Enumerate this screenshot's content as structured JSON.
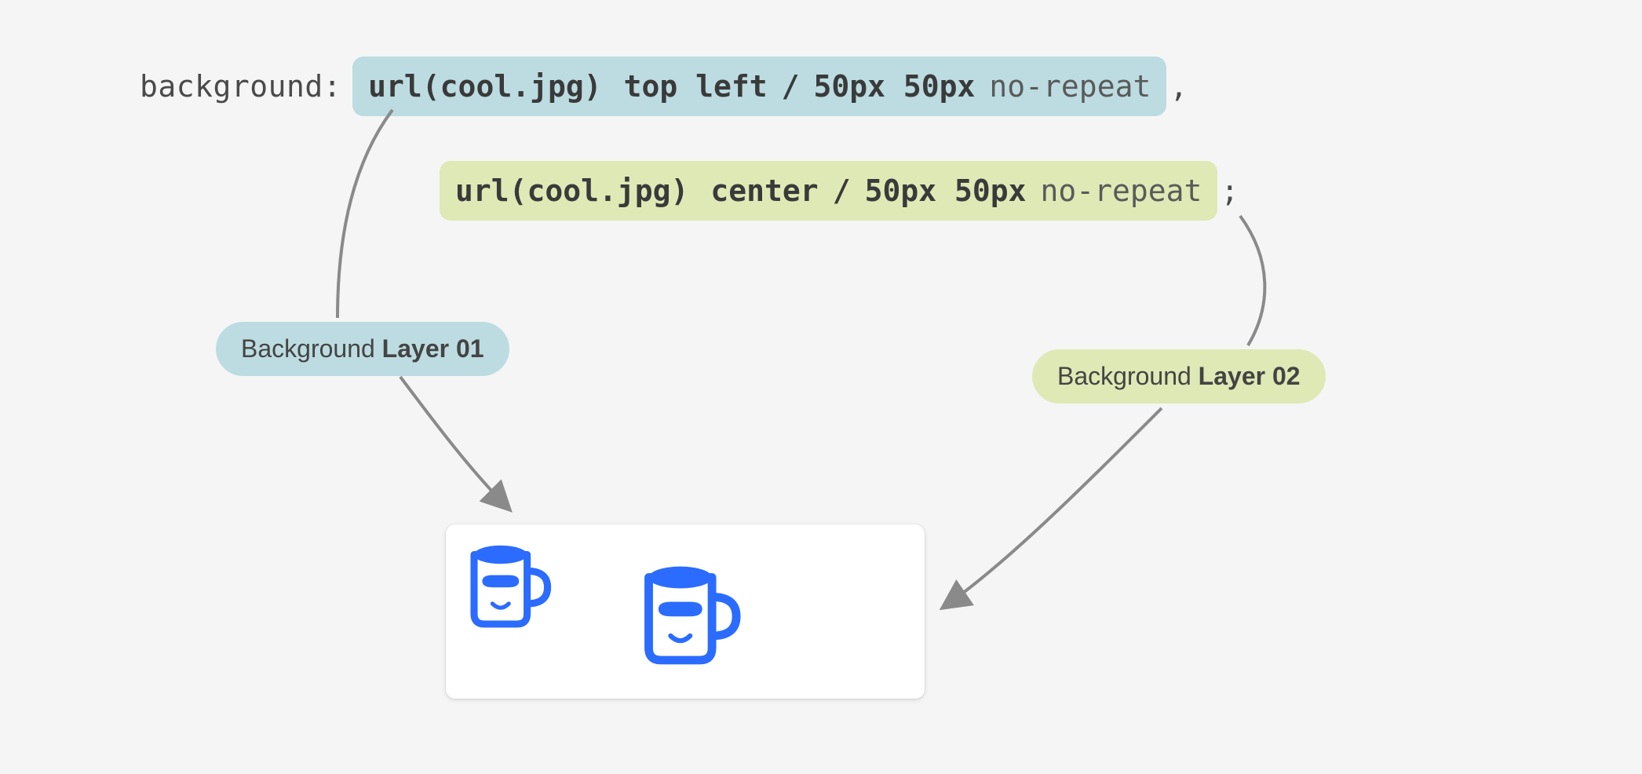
{
  "code": {
    "property": "background:",
    "layer1": {
      "url": "url(cool.jpg)",
      "position": "top left",
      "slash": "/",
      "size": "50px 50px",
      "repeat": "no-repeat"
    },
    "layer1_terminator": ",",
    "layer2": {
      "url": "url(cool.jpg)",
      "position": "center",
      "slash": "/",
      "size": "50px 50px",
      "repeat": "no-repeat"
    },
    "layer2_terminator": ";"
  },
  "labels": {
    "layer1_prefix": "Background ",
    "layer1_bold": "Layer 01",
    "layer2_prefix": "Background ",
    "layer2_bold": "Layer 02"
  },
  "colors": {
    "layer1_bg": "#bcdce1",
    "layer2_bg": "#dee9b5",
    "mug_blue": "#2b6cff",
    "arrow": "#8a8a8a"
  }
}
